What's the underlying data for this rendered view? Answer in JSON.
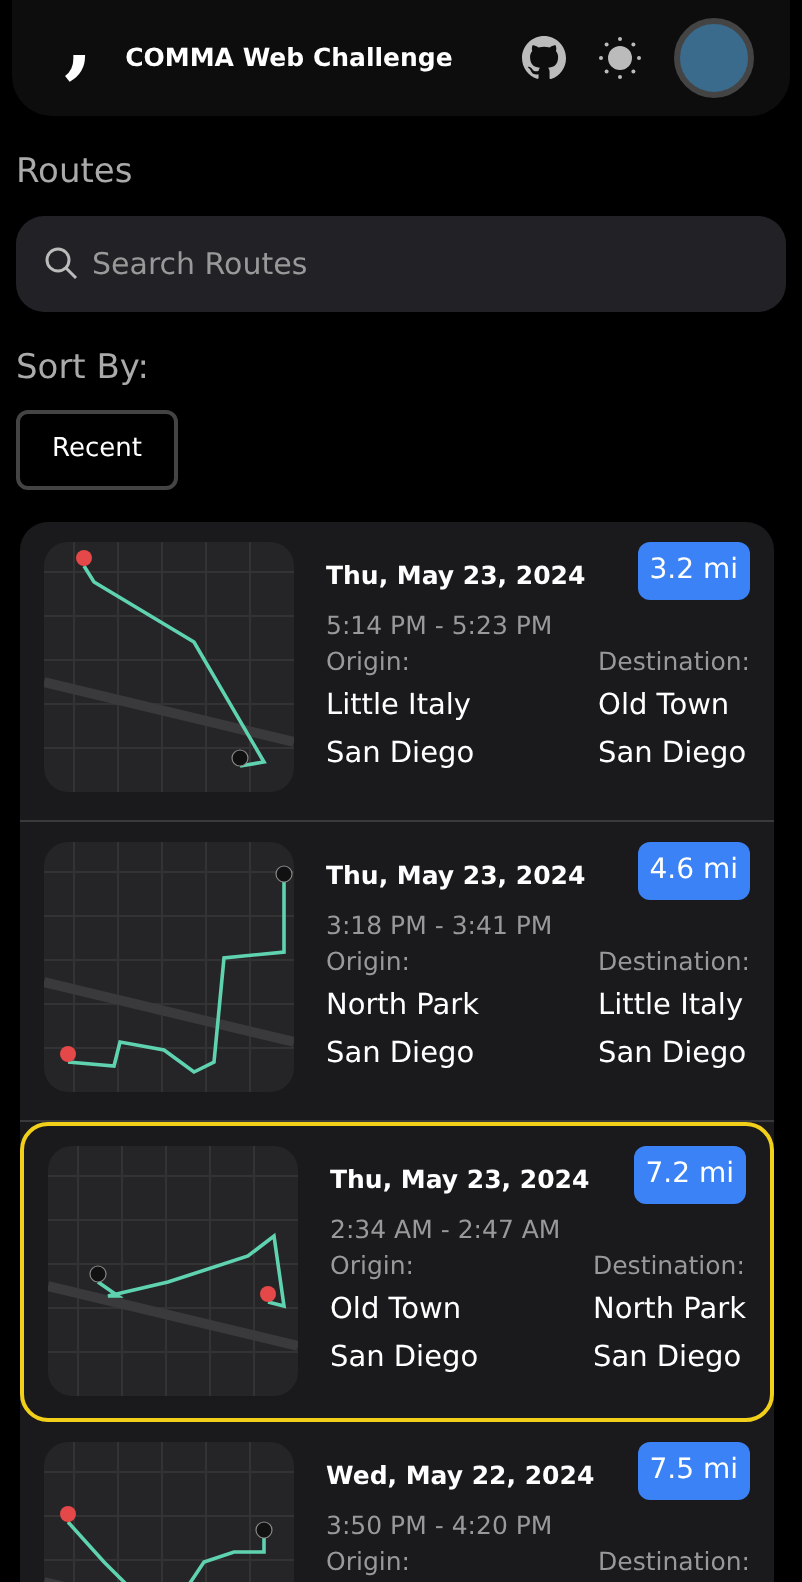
{
  "header": {
    "logo": ",",
    "title": "COMMA Web Challenge"
  },
  "routes_heading": "Routes",
  "search": {
    "placeholder": "Search Routes"
  },
  "sort": {
    "label": "Sort By:",
    "button": "Recent"
  },
  "routes": [
    {
      "date": "Thu, May 23, 2024",
      "time": "5:14 PM - 5:23 PM",
      "distance": "3.2 mi",
      "origin_label": "Origin:",
      "origin": [
        "Little Italy",
        "San Diego"
      ],
      "destination_label": "Destination:",
      "destination": [
        "Old Town",
        "San Diego"
      ],
      "selected": false
    },
    {
      "date": "Thu, May 23, 2024",
      "time": "3:18 PM - 3:41 PM",
      "distance": "4.6 mi",
      "origin_label": "Origin:",
      "origin": [
        "North Park",
        "San Diego"
      ],
      "destination_label": "Destination:",
      "destination": [
        "Little Italy",
        "San Diego"
      ],
      "selected": false
    },
    {
      "date": "Thu, May 23, 2024",
      "time": "2:34 AM - 2:47 AM",
      "distance": "7.2 mi",
      "origin_label": "Origin:",
      "origin": [
        "Old Town",
        "San Diego"
      ],
      "destination_label": "Destination:",
      "destination": [
        "North Park",
        "San Diego"
      ],
      "selected": true
    },
    {
      "date": "Wed, May 22, 2024",
      "time": "3:50 PM - 4:20 PM",
      "distance": "7.5 mi",
      "origin_label": "Origin:",
      "destination_label": "Destination:",
      "selected": false
    }
  ]
}
